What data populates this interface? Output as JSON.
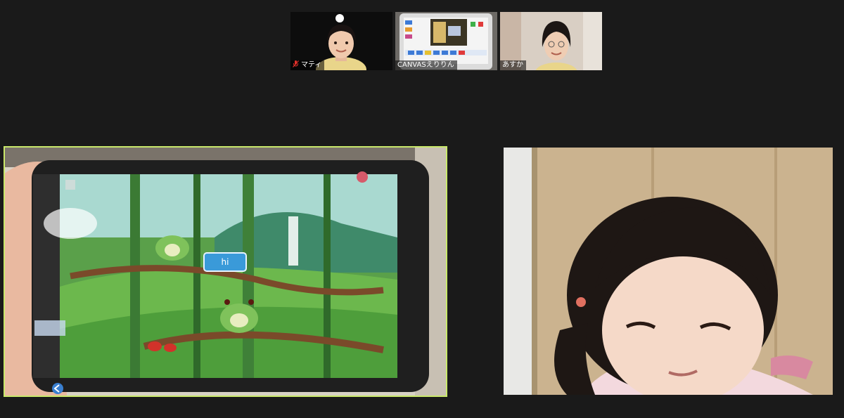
{
  "participants": [
    {
      "name": "マティ",
      "muted": true
    },
    {
      "name": "CANVASえりりん",
      "muted": false
    },
    {
      "name": "あすか",
      "muted": false
    }
  ],
  "shared_screen": {
    "speech_bubble": "hi"
  },
  "colors": {
    "background": "#1a1a1a",
    "active_speaker_border": "#c9e86a",
    "muted_mic": "#e0302a"
  }
}
